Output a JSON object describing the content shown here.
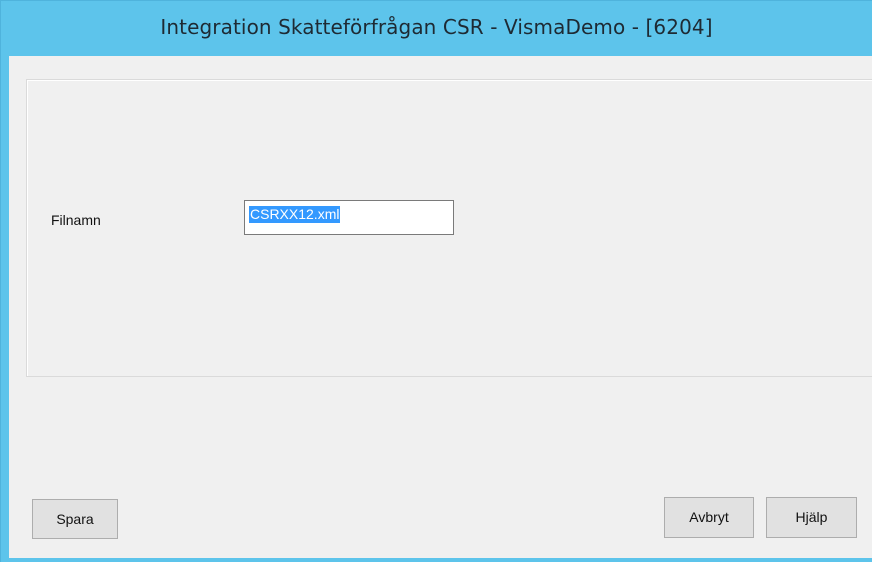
{
  "window": {
    "title": "Integration Skatteförfrågan CSR - VismaDemo - [6204]"
  },
  "form": {
    "filename_label": "Filnamn",
    "filename_value": "CSRXX12.xml"
  },
  "buttons": {
    "save_label": "Spara",
    "cancel_label": "Avbryt",
    "help_label": "Hjälp"
  },
  "colors": {
    "titlebar": "#5dc4eb",
    "client_background": "#f0f0f0",
    "selection": "#3399ff"
  }
}
